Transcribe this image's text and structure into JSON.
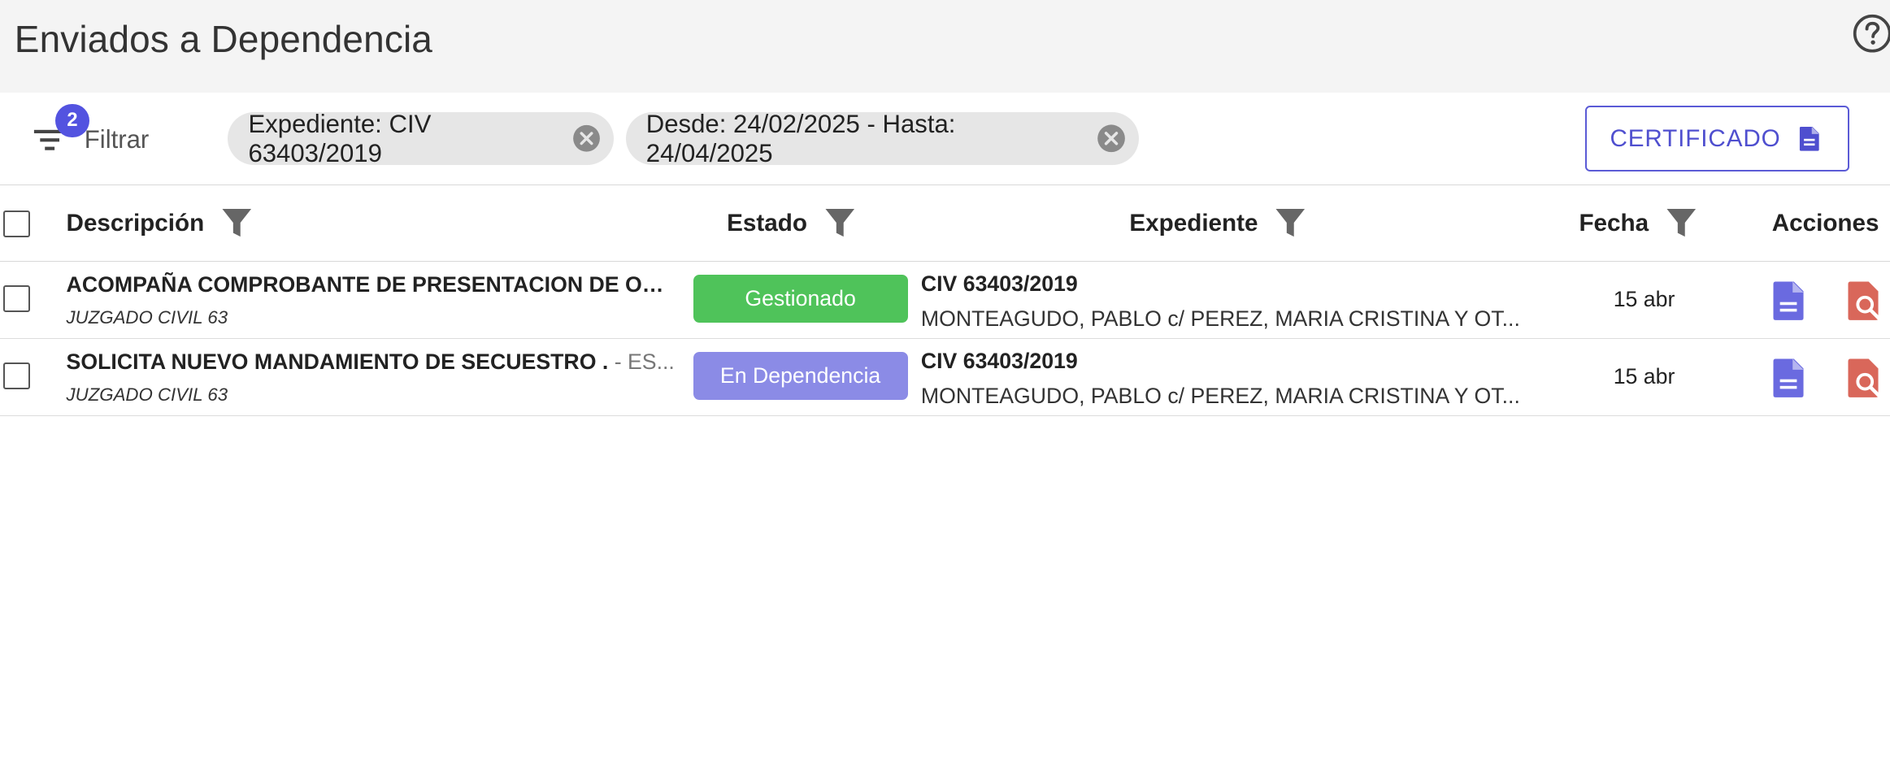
{
  "header": {
    "title": "Enviados a Dependencia"
  },
  "toolbar": {
    "filter_label": "Filtrar",
    "filter_count": "2",
    "chips": [
      {
        "label": "Expediente: CIV 63403/2019"
      },
      {
        "label": "Desde: 24/02/2025 - Hasta: 24/04/2025"
      }
    ],
    "certificate_label": "CERTIFICADO"
  },
  "table": {
    "columns": {
      "descripcion": "Descripción",
      "estado": "Estado",
      "expediente": "Expediente",
      "fecha": "Fecha",
      "acciones": "Acciones"
    },
    "rows": [
      {
        "description": "ACOMPAÑA COMPROBANTE DE PRESENTACION DE OFI...",
        "description_extra": "",
        "organ": "JUZGADO CIVIL 63",
        "status": "Gestionado",
        "expediente": "CIV 63403/2019",
        "caratula": "MONTEAGUDO, PABLO c/ PEREZ, MARIA CRISTINA Y OT...",
        "fecha": "15 abr"
      },
      {
        "description": "SOLICITA NUEVO MANDAMIENTO DE SECUESTRO .",
        "description_extra": " - ES...",
        "organ": "JUZGADO CIVIL 63",
        "status": "En Dependencia",
        "expediente": "CIV 63403/2019",
        "caratula": "MONTEAGUDO, PABLO c/ PEREZ, MARIA CRISTINA Y OT...",
        "fecha": "15 abr"
      }
    ]
  },
  "colors": {
    "accent": "#5353e0",
    "status_gestionado": "#4fc35a",
    "status_en_dependencia": "#8b8be6",
    "doc_icon": "#6a6ae0",
    "search_icon": "#d9675a",
    "funnel": "#666666"
  },
  "icons": {
    "help": "help-circle-icon",
    "filter": "filter-list-icon",
    "chip_close": "close-circle-icon",
    "certificate": "document-icon",
    "column_filter": "funnel-icon",
    "row_action_1": "document-icon",
    "row_action_2": "file-search-icon"
  }
}
